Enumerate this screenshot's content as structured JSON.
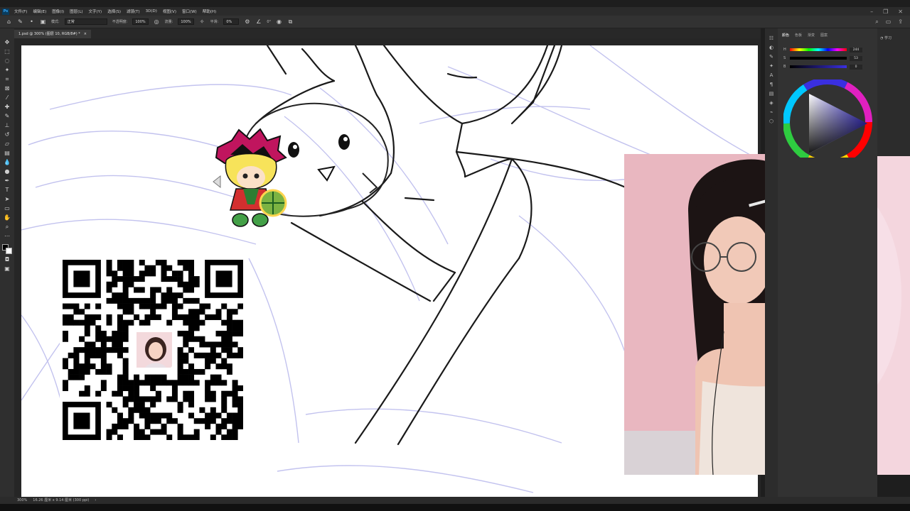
{
  "menubar": {
    "logo": "Ps",
    "items": [
      "文件(F)",
      "编辑(E)",
      "图像(I)",
      "图层(L)",
      "文字(Y)",
      "选择(S)",
      "滤镜(T)",
      "3D(D)",
      "视图(V)",
      "窗口(W)",
      "帮助(H)"
    ],
    "window_controls": [
      "–",
      "❐",
      "✕"
    ]
  },
  "options": {
    "mode_label": "模式:",
    "mode_value": "正常",
    "opacity_label": "不透明度:",
    "opacity_value": "100%",
    "flow_label": "流量:",
    "flow_value": "100%",
    "smoothing_label": "平滑:",
    "smoothing_value": "0%",
    "angle_value": "0°"
  },
  "document": {
    "tab_title": "1.psd @ 300% (图层 10, RGB/8#) *",
    "close": "×"
  },
  "status": {
    "zoom": "300%",
    "info": "16.26 厘米 x 9.14 厘米 (300 ppi)",
    "arrow": "›"
  },
  "right_panel": {
    "tabs": [
      "颜色",
      "色板",
      "渐变",
      "图案"
    ],
    "sliders": [
      {
        "label": "H",
        "value": "244"
      },
      {
        "label": "S",
        "value": "53"
      },
      {
        "label": "B",
        "value": "0"
      }
    ],
    "side_label": "学习"
  },
  "colors": {
    "accent": "#31a8ff",
    "canvas": "#ffffff",
    "sketch_blue": "#a9a9e8",
    "panel_bg": "#323232"
  }
}
